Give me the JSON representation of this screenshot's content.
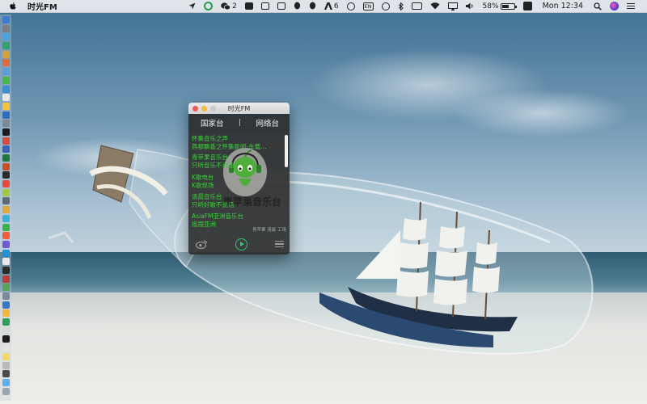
{
  "menubar": {
    "app_name": "时光FM",
    "wechat_count": "2",
    "adobe_count": "6",
    "input_source": "EN",
    "battery_percent": "58%",
    "battery_level": 0.58,
    "clock": "Mon 12:34"
  },
  "window": {
    "title": "时光FM",
    "tabs": {
      "national": "国家台",
      "separator": "|",
      "network": "网络台"
    },
    "stations": [
      {
        "name": "怀集音乐之声",
        "desc": "燕都飘香之怀集新闻-车载…"
      },
      {
        "name": "青苹果音乐台",
        "desc": "只听音乐不说话"
      },
      {
        "name": "K歌电台",
        "desc": "K歌现场"
      },
      {
        "name": "清晨音乐台",
        "desc": "只听好歌不说话"
      },
      {
        "name": "AsiaFM亚洲音乐台",
        "desc": "摇摆亚洲"
      }
    ],
    "watermark": "青苹果音乐台",
    "credit": "青苹果 清晨 工场",
    "controls": {
      "weibo_icon": "weibo-icon",
      "play_icon": "play-icon",
      "menu_icon": "menu-icon"
    },
    "accent_color": "#2fcb6b",
    "station_color": "#37d437"
  }
}
